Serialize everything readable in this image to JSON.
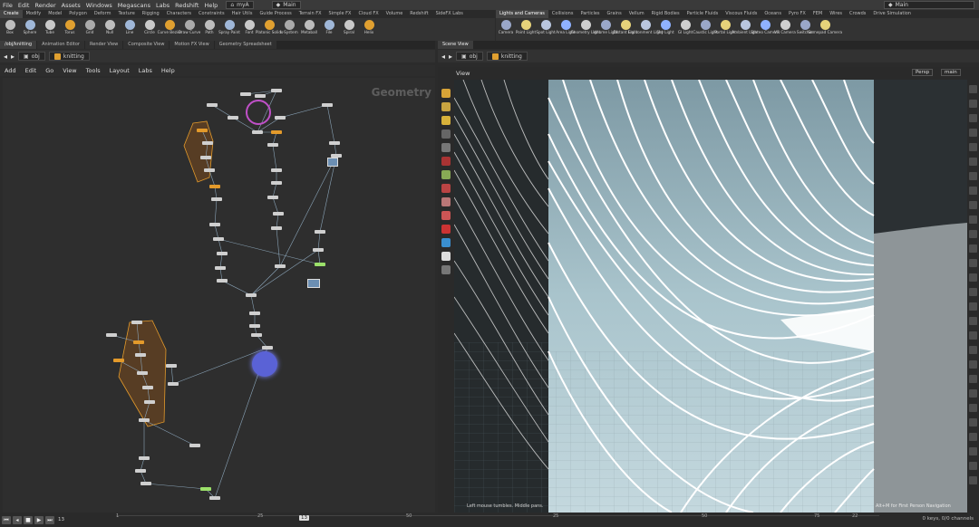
{
  "menubar": {
    "items": [
      "File",
      "Edit",
      "Render",
      "Assets",
      "Windows",
      "Megascans",
      "Labs",
      "Redshift",
      "Help"
    ],
    "scene_file": "myA",
    "desktop": "Main",
    "right_desktop": "Main"
  },
  "shelf_left": {
    "tabs": [
      "Create",
      "Modify",
      "Model",
      "Polygon",
      "Deform",
      "Texture",
      "Rigging",
      "Characters",
      "Constraints",
      "Hair Utils",
      "Guide Process",
      "Terrain FX",
      "Simple FX",
      "Cloud FX",
      "Volume",
      "Redshift",
      "SideFX Labs"
    ],
    "tools": [
      "Box",
      "Sphere",
      "Tube",
      "Torus",
      "Grid",
      "Null",
      "Line",
      "Circle",
      "Curve Bezier",
      "Draw Curve",
      "Path",
      "Spray Paint",
      "Font",
      "Platonic Solids",
      "L-System",
      "Metaball",
      "File",
      "Spiral",
      "Helix"
    ]
  },
  "shelf_right": {
    "tabs": [
      "Lights and Cameras",
      "Collisions",
      "Particles",
      "Grains",
      "Vellum",
      "Rigid Bodies",
      "Particle Fluids",
      "Viscous Fluids",
      "Oceans",
      "Pyro FX",
      "FEM",
      "Wires",
      "Crowds",
      "Drive Simulation"
    ],
    "tools": [
      "Camera",
      "Point Light",
      "Spot Light",
      "Area Light",
      "Geometry Light",
      "Volume Light",
      "Distant Light",
      "Environment Light",
      "Sky Light",
      "GI Light",
      "Caustic Light",
      "Portal Light",
      "Ambient Light",
      "Stereo Camera",
      "VR Camera",
      "Switcher",
      "Gamepad Camera"
    ]
  },
  "left_pane": {
    "tabs": [
      "/obj/knitting",
      "Animation Editor",
      "Render View",
      "Composite View",
      "Motion FX View",
      "Geometry Spreadsheet"
    ],
    "path": [
      "obj",
      "knitting"
    ],
    "menu": [
      "Add",
      "Edit",
      "Go",
      "View",
      "Tools",
      "Layout",
      "Labs",
      "Help"
    ],
    "context_title": "Geometry"
  },
  "right_pane": {
    "tabs": [
      "Scene View"
    ],
    "path": [
      "obj",
      "knitting"
    ],
    "view_label": "View",
    "camera": "Persp",
    "viewport_name": "main",
    "status_hint": "Left mouse tumbles. Middle pans.",
    "status_hint_right": "Alt+M for First Person Navigation"
  },
  "timeline": {
    "ticks": [
      "1",
      "25",
      "50",
      "25",
      "50",
      "75",
      "22"
    ],
    "current_frame": "13",
    "frame_field": "13",
    "keys_text": "0 keys, 0/0 channels"
  },
  "colors": {
    "accent": "#e39a2b",
    "select_ring": "#c050c8",
    "output_node": "#5a62d6",
    "sky": "#a9c4cc"
  }
}
